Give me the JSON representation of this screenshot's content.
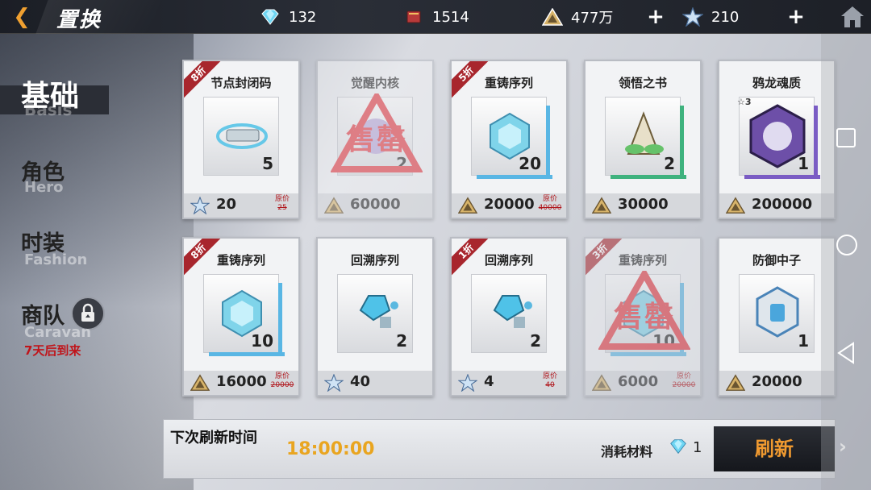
{
  "header": {
    "back_icon": "back-arrow-icon",
    "title": "置换",
    "resources": [
      {
        "name": "crystal",
        "icon": "crystal-icon",
        "value": "132"
      },
      {
        "name": "book",
        "icon": "book-icon",
        "value": "1514"
      },
      {
        "name": "gold",
        "icon": "gold-triangle-icon",
        "value": "477万"
      },
      {
        "name": "star",
        "icon": "star-icon",
        "value": "210"
      }
    ],
    "plus": "+"
  },
  "nav": {
    "basis": {
      "zh": "基础",
      "en": "Basis"
    },
    "role": {
      "zh": "角色",
      "en": "Hero"
    },
    "fashion": {
      "zh": "时装",
      "en": "Fashion"
    },
    "caravan": {
      "zh": "商队",
      "en": "Caravan",
      "note": "7天后到来"
    }
  },
  "shop": {
    "items": [
      {
        "name": "节点封闭码",
        "qty": "5",
        "price": "20",
        "currency": "star",
        "discount": "8折",
        "orig_label": "原价",
        "orig": "25",
        "soldout": false,
        "accent": ""
      },
      {
        "name": "觉醒内核",
        "qty": "2",
        "price": "60000",
        "currency": "gold",
        "discount": "",
        "orig_label": "",
        "orig": "",
        "soldout": true,
        "accent": ""
      },
      {
        "name": "重铸序列",
        "qty": "20",
        "price": "20000",
        "currency": "gold",
        "discount": "5折",
        "orig_label": "原价",
        "orig": "40000",
        "soldout": false,
        "accent": "#59b6e4"
      },
      {
        "name": "领悟之书",
        "qty": "2",
        "price": "30000",
        "currency": "gold",
        "discount": "",
        "orig_label": "",
        "orig": "",
        "soldout": false,
        "accent": "#3fb27e"
      },
      {
        "name": "鸦龙魂质",
        "qty": "1",
        "price": "200000",
        "currency": "gold",
        "discount": "",
        "orig_label": "",
        "orig": "",
        "soldout": false,
        "accent": "#7a5cc4",
        "star": "3"
      },
      {
        "name": "重铸序列",
        "qty": "10",
        "price": "16000",
        "currency": "gold",
        "discount": "8折",
        "orig_label": "原价",
        "orig": "20000",
        "soldout": false,
        "accent": "#59b6e4"
      },
      {
        "name": "回溯序列",
        "qty": "2",
        "price": "40",
        "currency": "star",
        "discount": "",
        "orig_label": "",
        "orig": "",
        "soldout": false,
        "accent": ""
      },
      {
        "name": "回溯序列",
        "qty": "2",
        "price": "4",
        "currency": "star",
        "discount": "1折",
        "orig_label": "原价",
        "orig": "40",
        "soldout": false,
        "accent": ""
      },
      {
        "name": "重铸序列",
        "qty": "10",
        "price": "6000",
        "currency": "gold",
        "discount": "3折",
        "orig_label": "原价",
        "orig": "20000",
        "soldout": true,
        "accent": "#59b6e4"
      },
      {
        "name": "防御中子",
        "qty": "1",
        "price": "20000",
        "currency": "gold",
        "discount": "",
        "orig_label": "",
        "orig": "",
        "soldout": false,
        "accent": ""
      }
    ],
    "soldout_text": "售罄"
  },
  "footer": {
    "refresh_label": "下次刷新时间",
    "refresh_time": "18:00:00",
    "cost_label": "消耗材料",
    "cost_icon": "crystal-icon",
    "cost_value": "1",
    "refresh_button": "刷新",
    "next_icon": "chevron-right-icon"
  },
  "system_nav": [
    "square-icon",
    "circle-icon",
    "triangle-back-icon"
  ]
}
